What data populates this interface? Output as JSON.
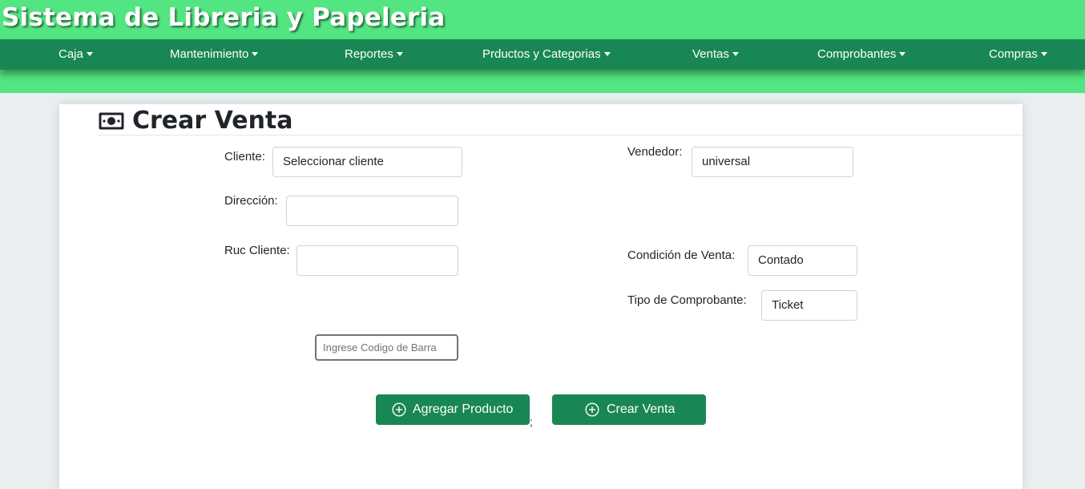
{
  "app": {
    "title": "Sistema de Libreria y Papeleria"
  },
  "nav": {
    "items": [
      {
        "label": "Caja"
      },
      {
        "label": "Mantenimiento"
      },
      {
        "label": "Reportes"
      },
      {
        "label": "Prductos y Categorias"
      },
      {
        "label": "Ventas"
      },
      {
        "label": "Comprobantes"
      },
      {
        "label": "Compras"
      }
    ]
  },
  "page": {
    "title": "Crear Venta",
    "icon": "money-bill-icon"
  },
  "form": {
    "cliente_label": "Cliente:",
    "cliente_value": "Seleccionar cliente",
    "direccion_label": "Dirección:",
    "direccion_value": "",
    "ruc_label": "Ruc Cliente:",
    "ruc_value": "",
    "vendedor_label": "Vendedor:",
    "vendedor_value": "universal",
    "condicion_label": "Condición de Venta:",
    "condicion_value": "Contado",
    "tipo_label": "Tipo de Comprobante:",
    "tipo_value": "Ticket",
    "barcode_placeholder": "Ingrese Codigo de Barra",
    "stray_text": ";"
  },
  "actions": {
    "add_product_label": "Agregar Producto",
    "create_sale_label": "Crear Venta",
    "icon": "plus-circle-icon"
  },
  "colors": {
    "header_bg": "#52e581",
    "navbar_bg": "#198754",
    "button_bg": "#198754"
  }
}
